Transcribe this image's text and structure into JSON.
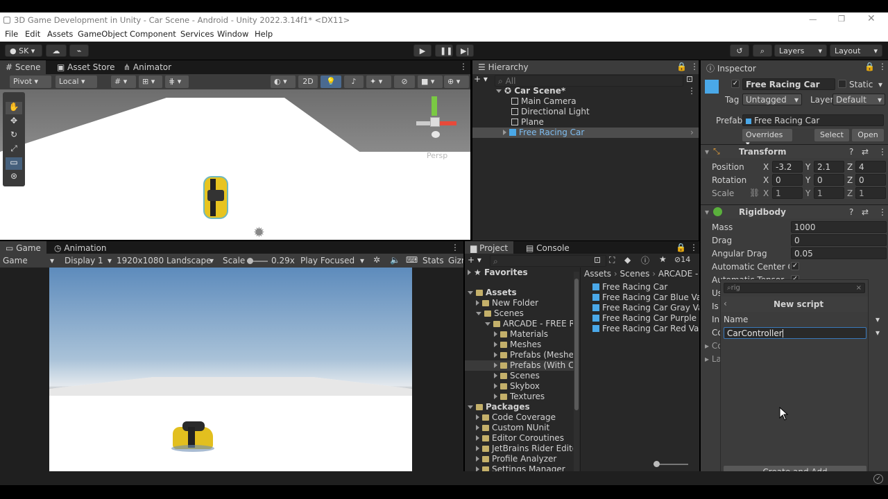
{
  "window": {
    "title": "3D Game Development in Unity - Car Scene - Android - Unity 2022.3.14f1* <DX11>"
  },
  "menu": [
    "File",
    "Edit",
    "Assets",
    "GameObject",
    "Component",
    "Services",
    "Window",
    "Help"
  ],
  "toolbar": {
    "account": "SK",
    "layers": "Layers",
    "layout": "Layout"
  },
  "scene": {
    "tabs": [
      "Scene",
      "Asset Store",
      "Animator"
    ],
    "pivot": "Pivot",
    "local": "Local",
    "mode2d": "2D",
    "persp": "Persp"
  },
  "hierarchy": {
    "tab": "Hierarchy",
    "search_placeholder": "All",
    "root": "Car Scene*",
    "items": [
      "Main Camera",
      "Directional Light",
      "Plane",
      "Free Racing Car"
    ]
  },
  "inspector": {
    "tab": "Inspector",
    "object_name": "Free Racing Car",
    "static_label": "Static",
    "tag_label": "Tag",
    "tag_value": "Untagged",
    "layer_label": "Layer",
    "layer_value": "Default",
    "prefab_label": "Prefab",
    "prefab_value": "Free Racing Car",
    "overrides": "Overrides",
    "select": "Select",
    "open": "Open",
    "transform": {
      "title": "Transform",
      "position": {
        "label": "Position",
        "x": "-3.2",
        "y": "2.1",
        "z": "4"
      },
      "rotation": {
        "label": "Rotation",
        "x": "0",
        "y": "0",
        "z": "0"
      },
      "scale": {
        "label": "Scale",
        "x": "1",
        "y": "1",
        "z": "1"
      }
    },
    "rigidbody": {
      "title": "Rigidbody",
      "mass_label": "Mass",
      "mass": "1000",
      "drag_label": "Drag",
      "drag": "0",
      "angular_label": "Angular Drag",
      "angular": "0.05",
      "auto_center": "Automatic Center Of I",
      "auto_tensor": "Automatic Tensor",
      "cut_labels": [
        "Us",
        "Is",
        "In",
        "Co",
        "Co",
        "La"
      ]
    },
    "popup": {
      "search_placeholder": "rig",
      "title": "New script",
      "name_label": "Name",
      "name_value": "CarController",
      "create_button": "Create and Add"
    }
  },
  "game": {
    "tabs": [
      "Game",
      "Animation"
    ],
    "mode": "Game",
    "display": "Display 1",
    "resolution": "1920x1080 Landscape",
    "scale_label": "Scale",
    "scale_value": "0.29x",
    "play_mode": "Play Focused",
    "stats": "Stats",
    "gizmos": "Gizm"
  },
  "project": {
    "tabs": [
      "Project",
      "Console"
    ],
    "hidden_count": "14",
    "favorites": "Favorites",
    "assets_label": "Assets",
    "tree": [
      {
        "label": "New Folder",
        "indent": 1
      },
      {
        "label": "Scenes",
        "indent": 1,
        "open": true
      },
      {
        "label": "ARCADE - FREE Ra",
        "indent": 2,
        "open": true
      },
      {
        "label": "Materials",
        "indent": 3
      },
      {
        "label": "Meshes",
        "indent": 3
      },
      {
        "label": "Prefabs (Meshes",
        "indent": 3
      },
      {
        "label": "Prefabs (With Co",
        "indent": 3
      },
      {
        "label": "Scenes",
        "indent": 3
      },
      {
        "label": "Skybox",
        "indent": 3
      },
      {
        "label": "Textures",
        "indent": 3
      }
    ],
    "packages_label": "Packages",
    "packages": [
      "Code Coverage",
      "Custom NUnit",
      "Editor Coroutines",
      "JetBrains Rider Editor",
      "Profile Analyzer",
      "Settings Manager"
    ],
    "breadcrumb": [
      "Assets",
      "Scenes",
      "ARCADE -"
    ],
    "files": [
      "Free Racing Car",
      "Free Racing Car Blue Varia",
      "Free Racing Car Gray Vari",
      "Free Racing Car Purple Va",
      "Free Racing Car Red Varia"
    ]
  }
}
